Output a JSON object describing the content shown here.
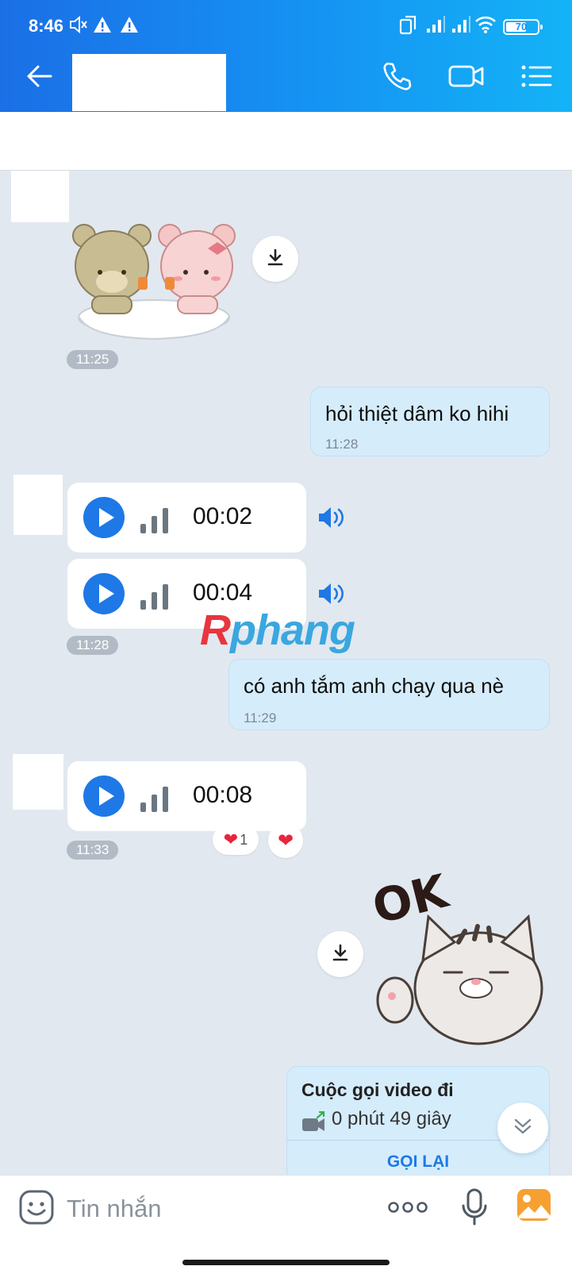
{
  "status_bar": {
    "time": "8:46",
    "battery": "70",
    "battery_level": 0.7,
    "icons": [
      "mute-icon",
      "warning-icon",
      "warning-icon",
      "sim-dual-icon",
      "signal-icon",
      "signal-icon",
      "wifi-icon",
      "battery-icon"
    ]
  },
  "header": {
    "back_icon": "arrow-left-icon",
    "call_icon": "phone-icon",
    "video_icon": "video-camera-icon",
    "menu_icon": "list-menu-icon"
  },
  "messages": {
    "sticker_bears_time": "11:25",
    "out1_text": "hỏi thiệt dâm ko hihi",
    "out1_time": "11:28",
    "voice1_duration": "00:02",
    "voice2_duration": "00:04",
    "voice_group1_time": "11:28",
    "out2_text": "có anh tắm anh chạy qua nè",
    "out2_time": "11:29",
    "voice3_duration": "00:08",
    "voice3_reaction_count": "1",
    "voice3_time": "11:33",
    "sticker_cat_text": "OK"
  },
  "call_card": {
    "title": "Cuộc gọi video đi",
    "duration": "0 phút 49 giây",
    "action": "GỌI LẠI"
  },
  "watermark": "Rphang",
  "input_bar": {
    "placeholder": "Tin nhắn",
    "emoji_icon": "sticker-face-icon",
    "more_icon": "more-dots-icon",
    "mic_icon": "microphone-icon",
    "image_icon": "image-gallery-icon"
  },
  "colors": {
    "header_start": "#1b6fe6",
    "header_end": "#14b3f6",
    "chat_bg": "#e2e8ef",
    "outgoing_bubble": "#d5ecfb",
    "accent": "#1e78e6",
    "heart": "#e8253b"
  }
}
